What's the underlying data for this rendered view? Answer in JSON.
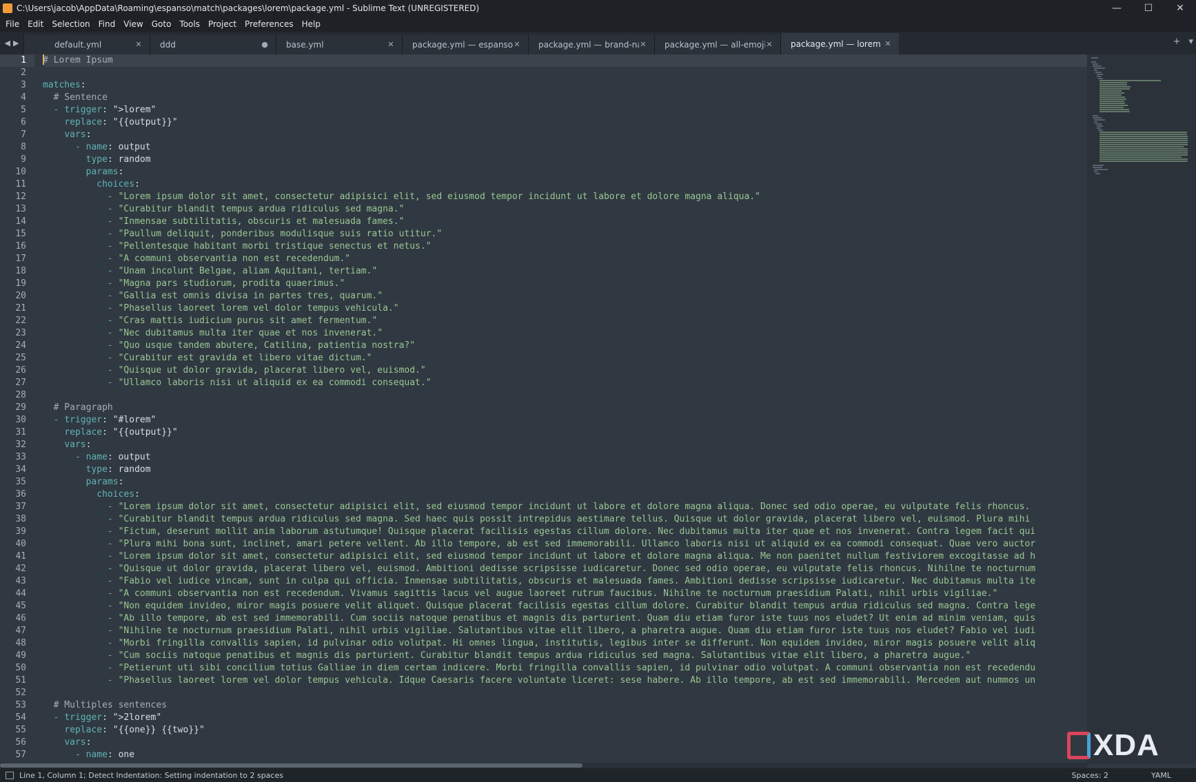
{
  "window": {
    "title": "C:\\Users\\jacob\\AppData\\Roaming\\espanso\\match\\packages\\lorem\\package.yml - Sublime Text (UNREGISTERED)",
    "controls": [
      "—",
      "☐",
      "✕"
    ]
  },
  "menu": [
    "File",
    "Edit",
    "Selection",
    "Find",
    "View",
    "Goto",
    "Tools",
    "Project",
    "Preferences",
    "Help"
  ],
  "tabs": [
    {
      "label": "default.yml",
      "marker": "✕",
      "active": false
    },
    {
      "label": "ddd",
      "marker": "●",
      "active": false
    },
    {
      "label": "base.yml",
      "marker": "✕",
      "active": false
    },
    {
      "label": "package.yml — espanso-dice",
      "marker": "✕",
      "active": false
    },
    {
      "label": "package.yml — brand-names",
      "marker": "✕",
      "active": false
    },
    {
      "label": "package.yml — all-emojis",
      "marker": "✕",
      "active": false
    },
    {
      "label": "package.yml — lorem",
      "marker": "✕",
      "active": true
    }
  ],
  "tab_actions": [
    "+",
    "▾"
  ],
  "editor": {
    "current_line": 1,
    "lines": [
      {
        "n": "1",
        "i": 0,
        "t": "comment",
        "text": "# Lorem Ipsum"
      },
      {
        "n": "2",
        "i": 0,
        "t": "blank"
      },
      {
        "n": "3",
        "i": 0,
        "t": "key",
        "k": "matches"
      },
      {
        "n": "4",
        "i": 2,
        "t": "comment",
        "text": "# Sentence"
      },
      {
        "n": "5",
        "i": 2,
        "t": "kv",
        "dash": true,
        "k": "trigger",
        "v": "\">lorem\"",
        "vt": "plain"
      },
      {
        "n": "6",
        "i": 4,
        "t": "kv",
        "k": "replace",
        "v": "\"{{output}}\"",
        "vt": "plain"
      },
      {
        "n": "7",
        "i": 4,
        "t": "key",
        "k": "vars"
      },
      {
        "n": "8",
        "i": 6,
        "t": "kv",
        "dash": true,
        "k": "name",
        "v": "output",
        "vt": "plain"
      },
      {
        "n": "9",
        "i": 8,
        "t": "kv",
        "k": "type",
        "v": "random",
        "vt": "plain"
      },
      {
        "n": "10",
        "i": 8,
        "t": "key",
        "k": "params"
      },
      {
        "n": "11",
        "i": 10,
        "t": "key",
        "k": "choices"
      },
      {
        "n": "12",
        "i": 12,
        "t": "item",
        "text": "\"Lorem ipsum dolor sit amet, consectetur adipisici elit, sed eiusmod tempor incidunt ut labore et dolore magna aliqua.\""
      },
      {
        "n": "13",
        "i": 12,
        "t": "item",
        "text": "\"Curabitur blandit tempus ardua ridiculus sed magna.\""
      },
      {
        "n": "14",
        "i": 12,
        "t": "item",
        "text": "\"Inmensae subtilitatis, obscuris et malesuada fames.\""
      },
      {
        "n": "15",
        "i": 12,
        "t": "item",
        "text": "\"Paullum deliquit, ponderibus modulisque suis ratio utitur.\""
      },
      {
        "n": "16",
        "i": 12,
        "t": "item",
        "text": "\"Pellentesque habitant morbi tristique senectus et netus.\""
      },
      {
        "n": "17",
        "i": 12,
        "t": "item",
        "text": "\"A communi observantia non est recedendum.\""
      },
      {
        "n": "18",
        "i": 12,
        "t": "item",
        "text": "\"Unam incolunt Belgae, aliam Aquitani, tertiam.\""
      },
      {
        "n": "19",
        "i": 12,
        "t": "item",
        "text": "\"Magna pars studiorum, prodita quaerimus.\""
      },
      {
        "n": "20",
        "i": 12,
        "t": "item",
        "text": "\"Gallia est omnis divisa in partes tres, quarum.\""
      },
      {
        "n": "21",
        "i": 12,
        "t": "item",
        "text": "\"Phasellus laoreet lorem vel dolor tempus vehicula.\""
      },
      {
        "n": "22",
        "i": 12,
        "t": "item",
        "text": "\"Cras mattis iudicium purus sit amet fermentum.\""
      },
      {
        "n": "23",
        "i": 12,
        "t": "item",
        "text": "\"Nec dubitamus multa iter quae et nos invenerat.\""
      },
      {
        "n": "24",
        "i": 12,
        "t": "item",
        "text": "\"Quo usque tandem abutere, Catilina, patientia nostra?\""
      },
      {
        "n": "25",
        "i": 12,
        "t": "item",
        "text": "\"Curabitur est gravida et libero vitae dictum.\""
      },
      {
        "n": "26",
        "i": 12,
        "t": "item",
        "text": "\"Quisque ut dolor gravida, placerat libero vel, euismod.\""
      },
      {
        "n": "27",
        "i": 12,
        "t": "item",
        "text": "\"Ullamco laboris nisi ut aliquid ex ea commodi consequat.\""
      },
      {
        "n": "28",
        "i": 0,
        "t": "blank"
      },
      {
        "n": "29",
        "i": 2,
        "t": "comment",
        "text": "# Paragraph"
      },
      {
        "n": "30",
        "i": 2,
        "t": "kv",
        "dash": true,
        "k": "trigger",
        "v": "\"#lorem\"",
        "vt": "plain"
      },
      {
        "n": "31",
        "i": 4,
        "t": "kv",
        "k": "replace",
        "v": "\"{{output}}\"",
        "vt": "plain"
      },
      {
        "n": "32",
        "i": 4,
        "t": "key",
        "k": "vars"
      },
      {
        "n": "33",
        "i": 6,
        "t": "kv",
        "dash": true,
        "k": "name",
        "v": "output",
        "vt": "plain"
      },
      {
        "n": "34",
        "i": 8,
        "t": "kv",
        "k": "type",
        "v": "random",
        "vt": "plain"
      },
      {
        "n": "35",
        "i": 8,
        "t": "key",
        "k": "params"
      },
      {
        "n": "36",
        "i": 10,
        "t": "key",
        "k": "choices"
      },
      {
        "n": "37",
        "i": 12,
        "t": "item",
        "text": "\"Lorem ipsum dolor sit amet, consectetur adipisici elit, sed eiusmod tempor incidunt ut labore et dolore magna aliqua. Donec sed odio operae, eu vulputate felis rhoncus."
      },
      {
        "n": "38",
        "i": 12,
        "t": "item",
        "text": "\"Curabitur blandit tempus ardua ridiculus sed magna. Sed haec quis possit intrepidus aestimare tellus. Quisque ut dolor gravida, placerat libero vel, euismod. Plura mihi"
      },
      {
        "n": "39",
        "i": 12,
        "t": "item",
        "text": "\"Fictum, deserunt mollit anim laborum astutumque! Quisque placerat facilisis egestas cillum dolore. Nec dubitamus multa iter quae et nos invenerat. Contra legem facit qui"
      },
      {
        "n": "40",
        "i": 12,
        "t": "item",
        "text": "\"Plura mihi bona sunt, inclinet, amari petere vellent. Ab illo tempore, ab est sed immemorabili. Ullamco laboris nisi ut aliquid ex ea commodi consequat. Quae vero auctor"
      },
      {
        "n": "41",
        "i": 12,
        "t": "item",
        "text": "\"Lorem ipsum dolor sit amet, consectetur adipisici elit, sed eiusmod tempor incidunt ut labore et dolore magna aliqua. Me non paenitet nullum festiviorem excogitasse ad h"
      },
      {
        "n": "42",
        "i": 12,
        "t": "item",
        "text": "\"Quisque ut dolor gravida, placerat libero vel, euismod. Ambitioni dedisse scripsisse iudicaretur. Donec sed odio operae, eu vulputate felis rhoncus. Nihilne te nocturnum"
      },
      {
        "n": "43",
        "i": 12,
        "t": "item",
        "text": "\"Fabio vel iudice vincam, sunt in culpa qui officia. Inmensae subtilitatis, obscuris et malesuada fames. Ambitioni dedisse scripsisse iudicaretur. Nec dubitamus multa ite"
      },
      {
        "n": "44",
        "i": 12,
        "t": "item",
        "text": "\"A communi observantia non est recedendum. Vivamus sagittis lacus vel augue laoreet rutrum faucibus. Nihilne te nocturnum praesidium Palati, nihil urbis vigiliae.\""
      },
      {
        "n": "45",
        "i": 12,
        "t": "item",
        "text": "\"Non equidem invideo, miror magis posuere velit aliquet. Quisque placerat facilisis egestas cillum dolore. Curabitur blandit tempus ardua ridiculus sed magna. Contra lege"
      },
      {
        "n": "46",
        "i": 12,
        "t": "item",
        "text": "\"Ab illo tempore, ab est sed immemorabili. Cum sociis natoque penatibus et magnis dis parturient. Quam diu etiam furor iste tuus nos eludet? Ut enim ad minim veniam, quis"
      },
      {
        "n": "47",
        "i": 12,
        "t": "item",
        "text": "\"Nihilne te nocturnum praesidium Palati, nihil urbis vigiliae. Salutantibus vitae elit libero, a pharetra augue. Quam diu etiam furor iste tuus nos eludet? Fabio vel iudi"
      },
      {
        "n": "48",
        "i": 12,
        "t": "item",
        "text": "\"Morbi fringilla convallis sapien, id pulvinar odio volutpat. Hi omnes lingua, institutis, legibus inter se differunt. Non equidem invideo, miror magis posuere velit aliq"
      },
      {
        "n": "49",
        "i": 12,
        "t": "item",
        "text": "\"Cum sociis natoque penatibus et magnis dis parturient. Curabitur blandit tempus ardua ridiculus sed magna. Salutantibus vitae elit libero, a pharetra augue.\""
      },
      {
        "n": "50",
        "i": 12,
        "t": "item",
        "text": "\"Petierunt uti sibi concilium totius Galliae in diem certam indicere. Morbi fringilla convallis sapien, id pulvinar odio volutpat. A communi observantia non est recedendu"
      },
      {
        "n": "51",
        "i": 12,
        "t": "item",
        "text": "\"Phasellus laoreet lorem vel dolor tempus vehicula. Idque Caesaris facere voluntate liceret: sese habere. Ab illo tempore, ab est sed immemorabili. Mercedem aut nummos un"
      },
      {
        "n": "52",
        "i": 0,
        "t": "blank"
      },
      {
        "n": "53",
        "i": 2,
        "t": "comment",
        "text": "# Multiples sentences"
      },
      {
        "n": "54",
        "i": 2,
        "t": "kv",
        "dash": true,
        "k": "trigger",
        "v": "\">2lorem\"",
        "vt": "plain"
      },
      {
        "n": "55",
        "i": 4,
        "t": "kv",
        "k": "replace",
        "v": "\"{{one}} {{two}}\"",
        "vt": "plain"
      },
      {
        "n": "56",
        "i": 4,
        "t": "key",
        "k": "vars"
      },
      {
        "n": "57",
        "i": 6,
        "t": "kv",
        "dash": true,
        "k": "name",
        "v": "one",
        "vt": "plain"
      }
    ]
  },
  "status": {
    "message": "Line 1, Column 1; Detect Indentation: Setting indentation to 2 spaces",
    "spaces": "Spaces: 2",
    "syntax": "YAML"
  },
  "watermark": {
    "text": "XDA"
  },
  "colors": {
    "background": "#303841",
    "key": "#5fb4b4",
    "string": "#99c794",
    "comment": "#a7adba",
    "caret": "#f9ae58"
  }
}
